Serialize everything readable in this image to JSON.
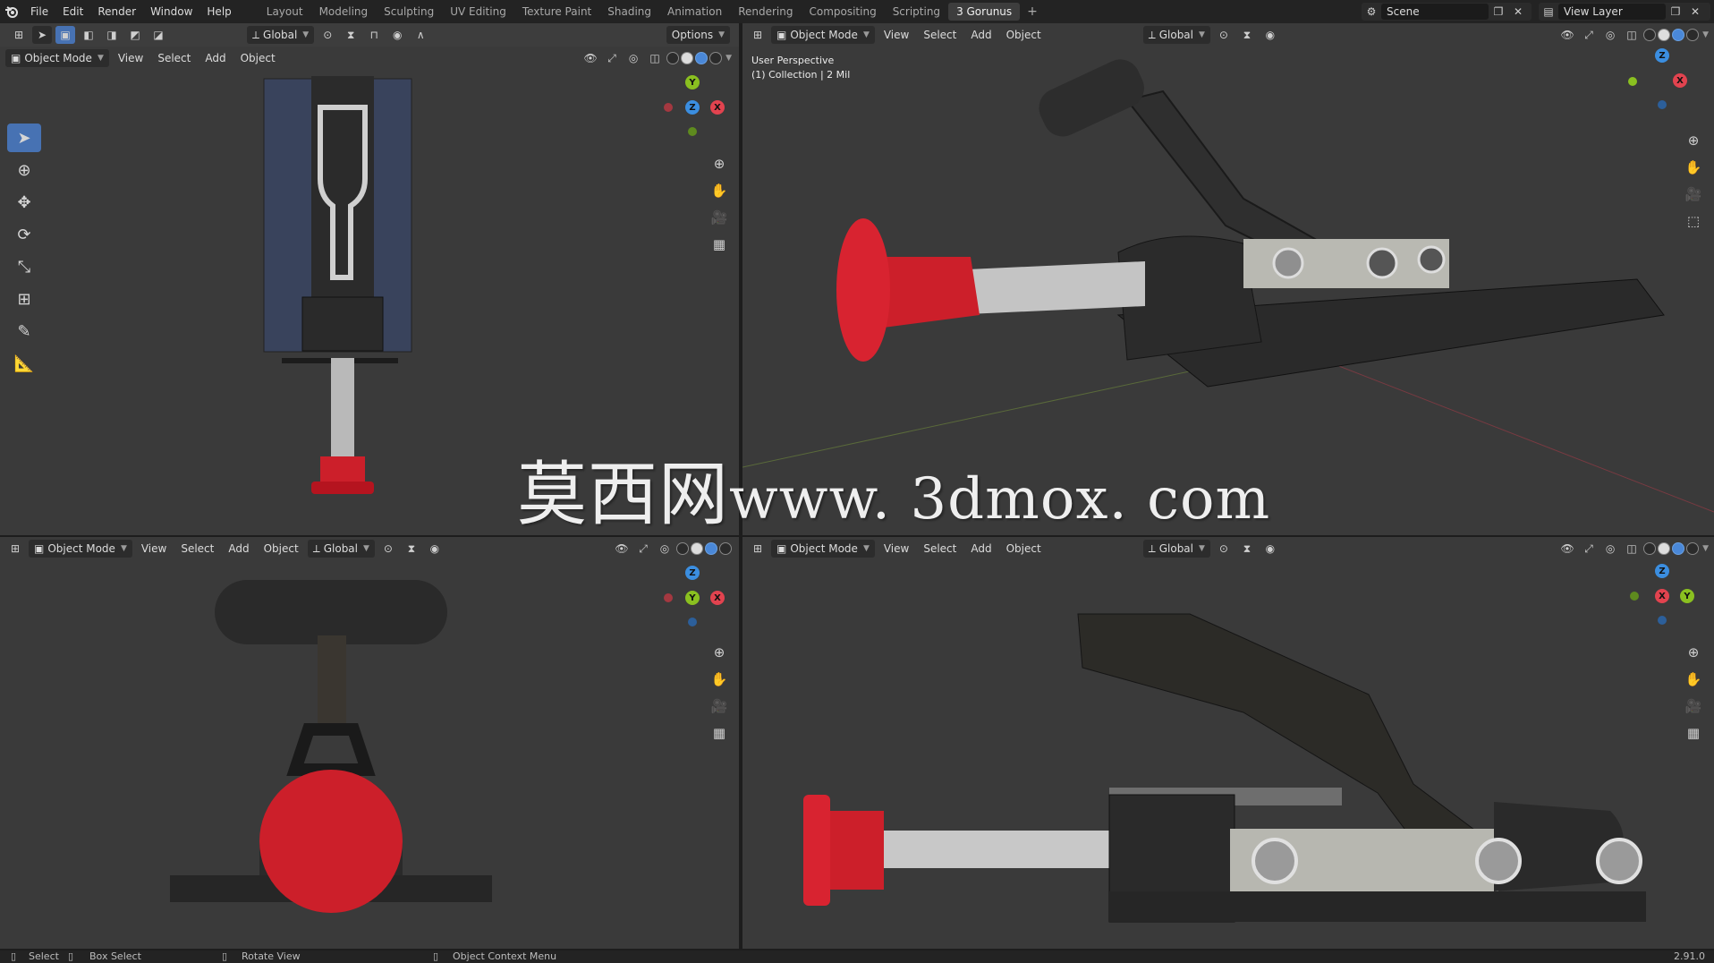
{
  "topbar": {
    "menu": [
      "File",
      "Edit",
      "Render",
      "Window",
      "Help"
    ],
    "workspaces": [
      "Layout",
      "Modeling",
      "Sculpting",
      "UV Editing",
      "Texture Paint",
      "Shading",
      "Animation",
      "Rendering",
      "Compositing",
      "Scripting",
      "3 Gorunus"
    ],
    "active_workspace": "3 Gorunus",
    "scene": "Scene",
    "view_layer": "View Layer"
  },
  "viewport_header": {
    "mode": "Object Mode",
    "view": "View",
    "select": "Select",
    "add": "Add",
    "object": "Object",
    "orientation": "Global",
    "options": "Options"
  },
  "viewport_topright": {
    "perspective_label": "User Perspective",
    "collection_label": "(1) Collection | 2 Mil"
  },
  "gizmo_labels": {
    "x": "X",
    "y": "Y",
    "z": "Z"
  },
  "watermark": {
    "cn": "莫西网",
    "url": "www. 3dmox. com"
  },
  "statusbar": {
    "select": "Select",
    "box_select": "Box Select",
    "rotate_view": "Rotate View",
    "context_menu": "Object Context Menu",
    "version": "2.91.0"
  },
  "colors": {
    "accent": "#4772b3",
    "axis_x": "#e2434f",
    "axis_y": "#8ac020",
    "axis_z": "#3b8ee0",
    "knob_red": "#cc1f2a",
    "body_black": "#2a2a2a"
  }
}
